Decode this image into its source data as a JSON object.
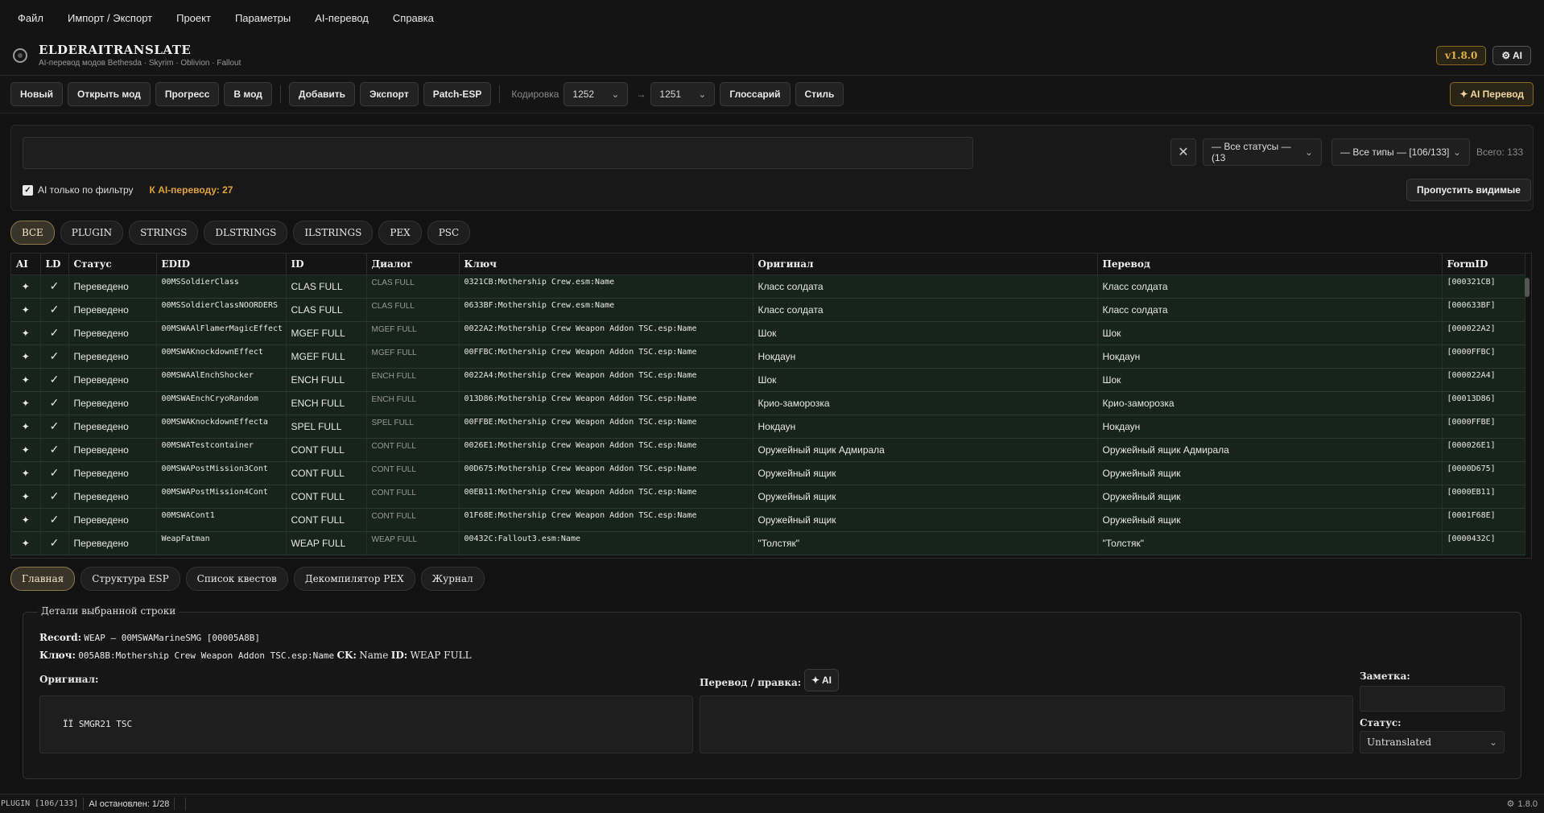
{
  "menu": [
    "Файл",
    "Импорт / Экспорт",
    "Проект",
    "Параметры",
    "AI-перевод",
    "Справка"
  ],
  "header": {
    "title": "ELDERAITRANSLATE",
    "subtitle": "AI-перевод модов Bethesda · Skyrim · Oblivion · Fallout",
    "version": "v1.8.0",
    "ai_badge": "⚙ AI"
  },
  "toolbar": {
    "new": "Новый",
    "open_mod": "Открыть мод",
    "progress": "Прогресс",
    "to_mod": "В мод",
    "add": "Добавить",
    "export": "Экспорт",
    "patch_esp": "Patch-ESP",
    "encoding_label": "Кодировка",
    "enc_from": "1252",
    "enc_to": "1251",
    "enc_arrow": "→",
    "glossary": "Глоссарий",
    "style": "Стиль",
    "ai_translate": "✦ AI Перевод"
  },
  "filter": {
    "search_value": "",
    "status_select": "— Все статусы — (13",
    "type_select": "— Все типы — [106/133]",
    "total": "Всего: 133",
    "ai_only_label": "AI только по фильтру",
    "ai_queue": "К AI-переводу: 27",
    "skip_visible": "Пропустить видимые"
  },
  "type_tabs": [
    "ВСЕ",
    "PLUGIN",
    "STRINGS",
    "DLSTRINGS",
    "ILSTRINGS",
    "PEX",
    "PSC"
  ],
  "table": {
    "headers": [
      "AI",
      "LD",
      "Статус",
      "EDID",
      "ID",
      "Диалог",
      "Ключ",
      "Оригинал",
      "Перевод",
      "FormID"
    ],
    "rows": [
      {
        "ai": "✦",
        "ld": "✓",
        "status": "Переведено",
        "edid": "00MSSoldierClass",
        "id": "CLAS FULL",
        "dlg": "CLAS FULL",
        "key": "0321CB:Mothership Crew.esm:Name",
        "orig": "Класс солдата",
        "tr": "Класс солдата",
        "formid": "[000321CB]"
      },
      {
        "ai": "✦",
        "ld": "✓",
        "status": "Переведено",
        "edid": "00MSSoldierClassNOORDERS",
        "id": "CLAS FULL",
        "dlg": "CLAS FULL",
        "key": "0633BF:Mothership Crew.esm:Name",
        "orig": "Класс солдата",
        "tr": "Класс солдата",
        "formid": "[000633BF]"
      },
      {
        "ai": "✦",
        "ld": "✓",
        "status": "Переведено",
        "edid": "00MSWAAlFlamerMagicEffect",
        "id": "MGEF FULL",
        "dlg": "MGEF FULL",
        "key": "0022A2:Mothership Crew Weapon Addon TSC.esp:Name",
        "orig": "Шок",
        "tr": "Шок",
        "formid": "[000022A2]"
      },
      {
        "ai": "✦",
        "ld": "✓",
        "status": "Переведено",
        "edid": "00MSWAKnockdownEffect",
        "id": "MGEF FULL",
        "dlg": "MGEF FULL",
        "key": "00FFBC:Mothership Crew Weapon Addon TSC.esp:Name",
        "orig": "Нокдаун",
        "tr": "Нокдаун",
        "formid": "[0000FFBC]"
      },
      {
        "ai": "✦",
        "ld": "✓",
        "status": "Переведено",
        "edid": "00MSWAAlEnchShocker",
        "id": "ENCH FULL",
        "dlg": "ENCH FULL",
        "key": "0022A4:Mothership Crew Weapon Addon TSC.esp:Name",
        "orig": "Шок",
        "tr": "Шок",
        "formid": "[000022A4]"
      },
      {
        "ai": "✦",
        "ld": "✓",
        "status": "Переведено",
        "edid": "00MSWAEnchCryoRandom",
        "id": "ENCH FULL",
        "dlg": "ENCH FULL",
        "key": "013D86:Mothership Crew Weapon Addon TSC.esp:Name",
        "orig": "Крио-заморозка",
        "tr": "Крио-заморозка",
        "formid": "[00013D86]"
      },
      {
        "ai": "✦",
        "ld": "✓",
        "status": "Переведено",
        "edid": "00MSWAKnockdownEffecta",
        "id": "SPEL FULL",
        "dlg": "SPEL FULL",
        "key": "00FFBE:Mothership Crew Weapon Addon TSC.esp:Name",
        "orig": "Нокдаун",
        "tr": "Нокдаун",
        "formid": "[0000FFBE]"
      },
      {
        "ai": "✦",
        "ld": "✓",
        "status": "Переведено",
        "edid": "00MSWATestcontainer",
        "id": "CONT FULL",
        "dlg": "CONT FULL",
        "key": "0026E1:Mothership Crew Weapon Addon TSC.esp:Name",
        "orig": "Оружейный ящик Адмирала",
        "tr": "Оружейный ящик Адмирала",
        "formid": "[000026E1]"
      },
      {
        "ai": "✦",
        "ld": "✓",
        "status": "Переведено",
        "edid": "00MSWAPostMission3Cont",
        "id": "CONT FULL",
        "dlg": "CONT FULL",
        "key": "00D675:Mothership Crew Weapon Addon TSC.esp:Name",
        "orig": "Оружейный ящик",
        "tr": "Оружейный ящик",
        "formid": "[0000D675]"
      },
      {
        "ai": "✦",
        "ld": "✓",
        "status": "Переведено",
        "edid": "00MSWAPostMission4Cont",
        "id": "CONT FULL",
        "dlg": "CONT FULL",
        "key": "00EB11:Mothership Crew Weapon Addon TSC.esp:Name",
        "orig": "Оружейный ящик",
        "tr": "Оружейный ящик",
        "formid": "[0000EB11]"
      },
      {
        "ai": "✦",
        "ld": "✓",
        "status": "Переведено",
        "edid": "00MSWACont1",
        "id": "CONT FULL",
        "dlg": "CONT FULL",
        "key": "01F68E:Mothership Crew Weapon Addon TSC.esp:Name",
        "orig": "Оружейный ящик",
        "tr": "Оружейный ящик",
        "formid": "[0001F68E]"
      },
      {
        "ai": "✦",
        "ld": "✓",
        "status": "Переведено",
        "edid": "WeapFatman",
        "id": "WEAP FULL",
        "dlg": "WEAP FULL",
        "key": "00432C:Fallout3.esm:Name",
        "orig": "\"Толстяк\"",
        "tr": "\"Толстяк\"",
        "formid": "[0000432C]"
      }
    ]
  },
  "bottom_tabs": [
    "Главная",
    "Структура ESP",
    "Список квестов",
    "Декомпилятор PEX",
    "Журнал"
  ],
  "details": {
    "legend": "Детали выбранной строки",
    "record_label": "Record:",
    "record_value": "WEAP – 00MSWAMarineSMG [00005A8B]",
    "key_label": "Ключ:",
    "key_value": "005A8B:Mothership Crew Weapon Addon TSC.esp:Name",
    "ck_label": "CK:",
    "ck_value": "Name",
    "id_label": "ID:",
    "id_value": "WEAP FULL",
    "original_label": "Оригинал:",
    "original_value": "ΪΪ SMGR21 TSC",
    "translation_label": "Перевод / правка:",
    "ai_button": "✦ AI",
    "note_label": "Заметка:",
    "status_label": "Статус:",
    "status_value": "Untranslated"
  },
  "statusbar": {
    "plugin_info": "PLUGIN [106/133]",
    "ai_state": "AI остановлен: 1/28",
    "version": "1.8.0"
  }
}
